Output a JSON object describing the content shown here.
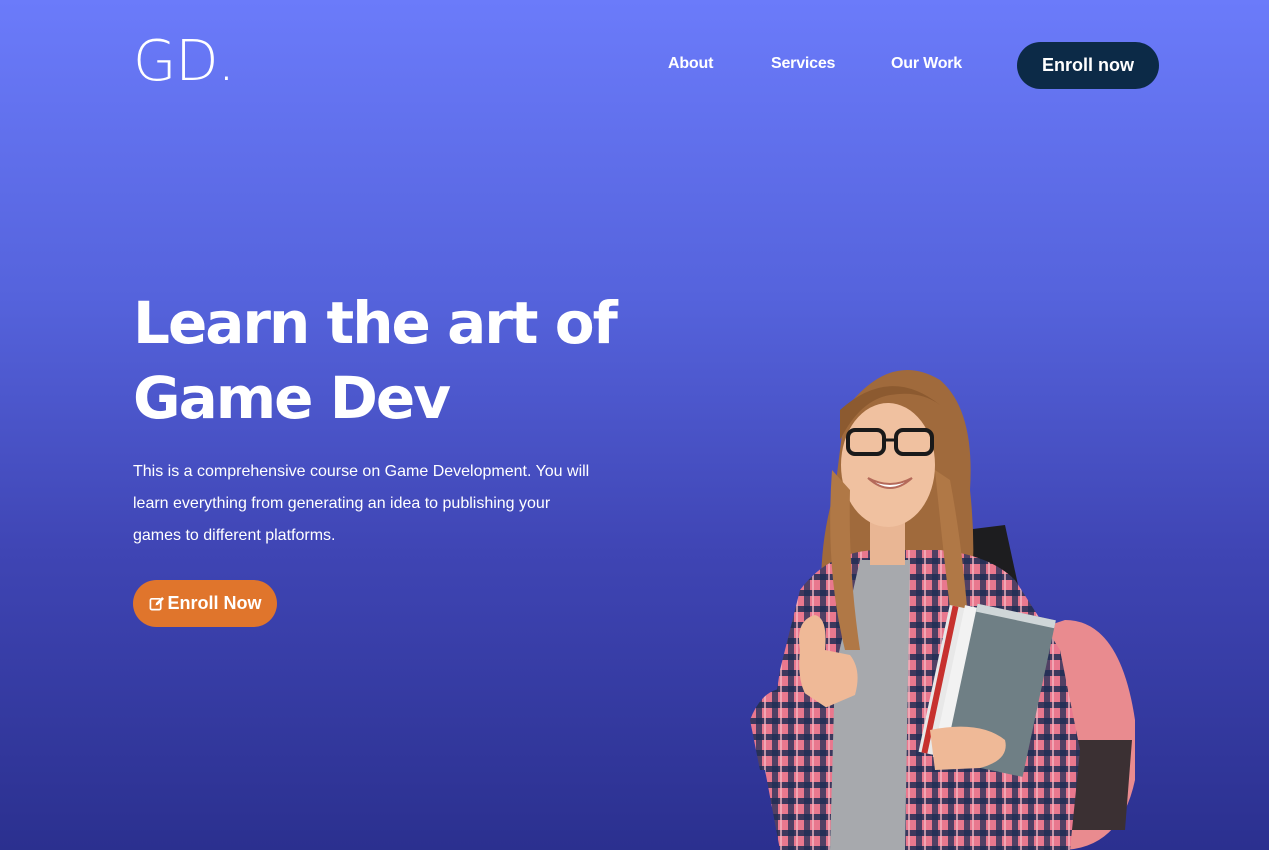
{
  "brand": {
    "logo": "GD."
  },
  "nav": {
    "links": [
      {
        "label": "About"
      },
      {
        "label": "Services"
      },
      {
        "label": "Our Work"
      }
    ],
    "enroll_label": "Enroll now"
  },
  "hero": {
    "title_line1": "Learn the art of",
    "title_line2": "Game Dev",
    "description": "This is a comprehensive course on Game Development. You will learn everything from generating an idea to publishing your games to different platforms.",
    "cta_label": "Enroll Now",
    "cta_icon": "edit-icon",
    "image_icon": "student-photo"
  },
  "colors": {
    "gradient_top": "#6b7bfa",
    "gradient_bottom": "#2b308f",
    "nav_button": "#0c2a47",
    "cta_button": "#e0752c"
  }
}
